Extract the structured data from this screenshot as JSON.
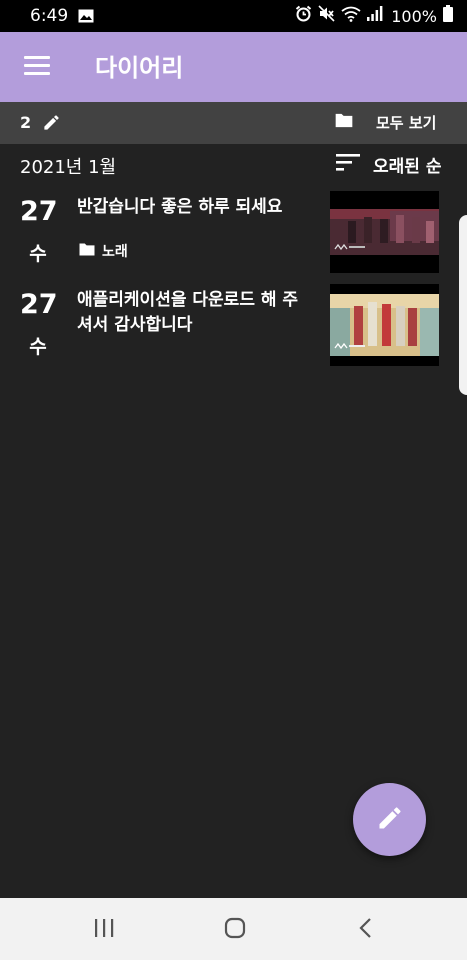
{
  "status_bar": {
    "time": "6:49",
    "battery": "100%",
    "icons": [
      "image-icon",
      "alarm-icon",
      "mute-icon",
      "wifi-icon",
      "signal-icon",
      "battery-icon"
    ]
  },
  "app_bar": {
    "title": "다이어리",
    "menu_icon": "menu-icon",
    "color": "#b39ddb"
  },
  "toolbar": {
    "count": "2",
    "view_all_label": "모두 보기"
  },
  "list_header": {
    "month": "2021년 1월",
    "sort_label": "오래된 순"
  },
  "entries": [
    {
      "day": "27",
      "weekday": "수",
      "title": "반갑습니다 좋은 하루 되세요",
      "folder": "노래",
      "thumbnail": "music-video-thumbnail"
    },
    {
      "day": "27",
      "weekday": "수",
      "title": "애플리케이션을 다운로드 해 주셔서 감사합니다",
      "folder": "",
      "thumbnail": "music-video-thumbnail"
    }
  ],
  "fab": {
    "icon": "pencil-icon",
    "color": "#b39ddb"
  },
  "nav_bar": {
    "buttons": [
      "recents-icon",
      "home-icon",
      "back-icon"
    ]
  }
}
